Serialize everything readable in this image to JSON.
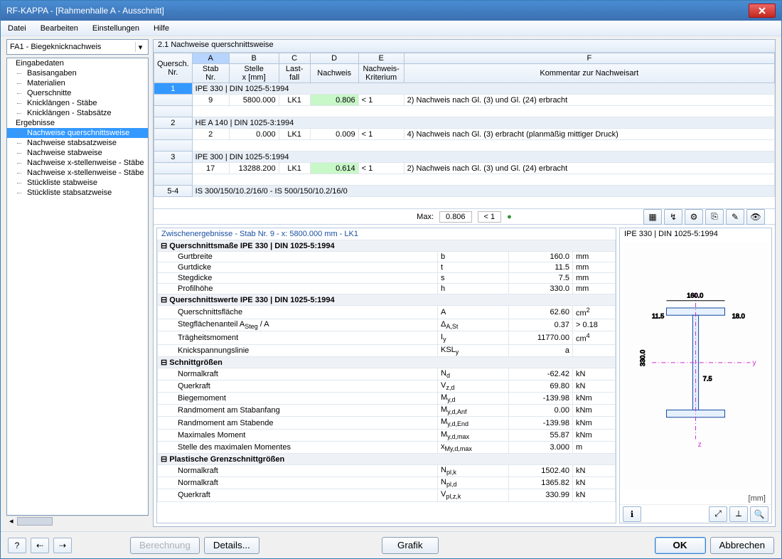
{
  "window": {
    "title": "RF-KAPPA - [Rahmenhalle A - Ausschnitt]"
  },
  "menu": [
    "Datei",
    "Bearbeiten",
    "Einstellungen",
    "Hilfe"
  ],
  "combo": "FA1 - Biegeknicknachweis",
  "tree": {
    "root1": "Eingabedaten",
    "children1": [
      "Basisangaben",
      "Materialien",
      "Querschnitte",
      "Knicklängen - Stäbe",
      "Knicklängen - Stabsätze"
    ],
    "root2": "Ergebnisse",
    "children2": [
      "Nachweise querschnittsweise",
      "Nachweise stabsatzweise",
      "Nachweise stabweise",
      "Nachweise x-stellenweise - Stäbe",
      "Nachweise x-stellenweise - Stäbe",
      "Stückliste stabweise",
      "Stückliste stabsatzweise"
    ],
    "selected": "Nachweise querschnittsweise"
  },
  "panel_title": "2.1 Nachweise querschnittsweise",
  "grid_cols": {
    "qs": "Quersch.\nNr.",
    "a": "Stab\nNr.",
    "b": "Stelle\nx [mm]",
    "c": "Last-\nfall",
    "d": "Nachweis",
    "e": "Nachweis-\nKriterium",
    "f": "Kommentar zur Nachweisart",
    "letters": [
      "A",
      "B",
      "C",
      "D",
      "E",
      "F"
    ]
  },
  "grid_rows": [
    {
      "head": "1",
      "group": "IPE 330 | DIN 1025-5:1994"
    },
    {
      "head": "",
      "stab": "9",
      "x": "5800.000",
      "lf": "LK1",
      "nw": "0.806",
      "krit": "< 1",
      "kom": "2) Nachweis nach Gl. (3) und Gl. (24) erbracht",
      "green": true
    },
    {
      "head": "",
      "blank": true
    },
    {
      "head": "2",
      "group": "HE A 140 | DIN 1025-3:1994"
    },
    {
      "head": "",
      "stab": "2",
      "x": "0.000",
      "lf": "LK1",
      "nw": "0.009",
      "krit": "< 1",
      "kom": "4) Nachweis nach Gl. (3) erbracht (planmäßig mittiger Druck)"
    },
    {
      "head": "",
      "blank": true
    },
    {
      "head": "3",
      "group": "IPE 300 | DIN 1025-5:1994"
    },
    {
      "head": "",
      "stab": "17",
      "x": "13288.200",
      "lf": "LK1",
      "nw": "0.614",
      "krit": "< 1",
      "kom": "2) Nachweis nach Gl. (3) und Gl. (24) erbracht",
      "green": true
    },
    {
      "head": "",
      "blank": true
    },
    {
      "head": "5-4",
      "group": "IS 300/150/10.2/16/0 - IS 500/150/10.2/16/0"
    }
  ],
  "max": {
    "label": "Max:",
    "value": "0.806",
    "crit": "< 1"
  },
  "details_title": "Zwischenergebnisse  -  Stab Nr.  9  -  x:  5800.000 mm  -  LK1",
  "sections": [
    {
      "title": "Querschnittsmaße  IPE 330 | DIN 1025-5:1994",
      "rows": [
        {
          "label": "Gurtbreite",
          "sym": "b",
          "val": "160.0",
          "unit": "mm"
        },
        {
          "label": "Gurtdicke",
          "sym": "t",
          "val": "11.5",
          "unit": "mm"
        },
        {
          "label": "Stegdicke",
          "sym": "s",
          "val": "7.5",
          "unit": "mm"
        },
        {
          "label": "Profilhöhe",
          "sym": "h",
          "val": "330.0",
          "unit": "mm"
        }
      ]
    },
    {
      "title": "Querschnittswerte  IPE 330 | DIN 1025-5:1994",
      "rows": [
        {
          "label": "Querschnittsfläche",
          "sym": "A",
          "val": "62.60",
          "unit": "cm²"
        },
        {
          "label": "Stegflächenanteil A_Steg / A",
          "sym": "Δ_A,St",
          "val": "0.37",
          "unit": "> 0.18"
        },
        {
          "label": "Trägheitsmoment",
          "sym": "I_y",
          "val": "11770.00",
          "unit": "cm⁴"
        },
        {
          "label": "Knickspannungslinie",
          "sym": "KSL_y",
          "val": "a",
          "unit": ""
        }
      ]
    },
    {
      "title": "Schnittgrößen",
      "rows": [
        {
          "label": "Normalkraft",
          "sym": "N_d",
          "val": "-62.42",
          "unit": "kN"
        },
        {
          "label": "Querkraft",
          "sym": "V_z,d",
          "val": "69.80",
          "unit": "kN"
        },
        {
          "label": "Biegemoment",
          "sym": "M_y,d",
          "val": "-139.98",
          "unit": "kNm"
        },
        {
          "label": "Randmoment am Stabanfang",
          "sym": "M_y,d,Anf",
          "val": "0.00",
          "unit": "kNm"
        },
        {
          "label": "Randmoment am Stabende",
          "sym": "M_y,d,End",
          "val": "-139.98",
          "unit": "kNm"
        },
        {
          "label": "Maximales Moment",
          "sym": "M_y,d,max",
          "val": "55.87",
          "unit": "kNm"
        },
        {
          "label": "Stelle des maximalen Momentes",
          "sym": "x_My,d,max",
          "val": "3.000",
          "unit": "m"
        }
      ]
    },
    {
      "title": "Plastische Grenzschnittgrößen",
      "rows": [
        {
          "label": "Normalkraft",
          "sym": "N_pl,k",
          "val": "1502.40",
          "unit": "kN"
        },
        {
          "label": "Normalkraft",
          "sym": "N_pl,d",
          "val": "1365.82",
          "unit": "kN"
        },
        {
          "label": "Querkraft",
          "sym": "V_pl,z,k",
          "val": "330.99",
          "unit": "kN"
        }
      ]
    }
  ],
  "preview": {
    "title": "IPE 330 | DIN 1025-5:1994",
    "dims": {
      "b": "160.0",
      "t": "11.5",
      "s": "7.5",
      "h": "330.0",
      "flange_ext": "18.0"
    },
    "unit_label": "[mm]"
  },
  "buttons": {
    "berechnung": "Berechnung",
    "details": "Details...",
    "grafik": "Grafik",
    "ok": "OK",
    "abbrechen": "Abbrechen"
  }
}
